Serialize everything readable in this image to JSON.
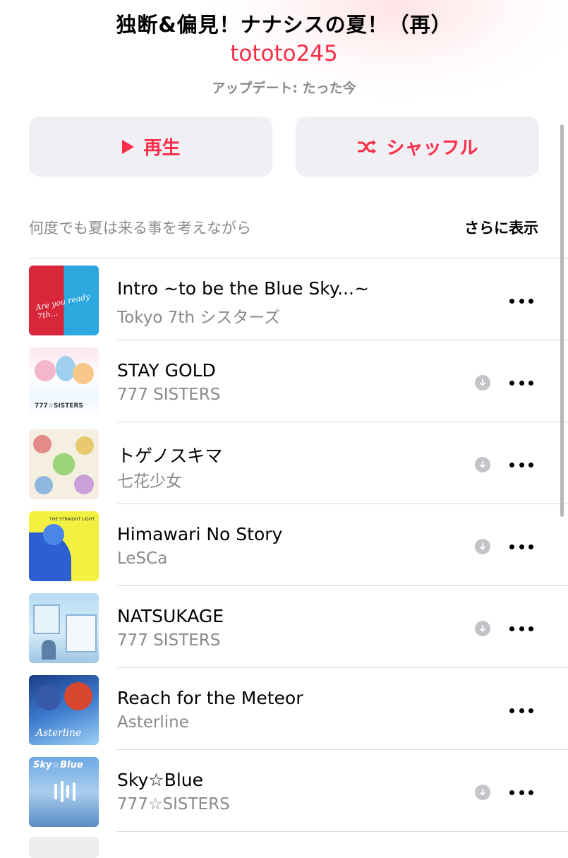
{
  "header": {
    "title": "独断&偏見！ナナシスの夏！（再）",
    "curator": "tototo245",
    "updated": "アップデート: たった今"
  },
  "actions": {
    "play_label": "再生",
    "shuffle_label": "シャッフル"
  },
  "description": {
    "text": "何度でも夏は来る事を考えながら",
    "more_label": "さらに表示"
  },
  "colors": {
    "accent": "#fa2d48",
    "secondary_text": "#8a8a8e",
    "button_bg": "#efeff4"
  },
  "tracks": [
    {
      "title": "Intro ~to be the Blue Sky...~",
      "artist": "Tokyo 7th シスターズ",
      "downloaded_icon": false,
      "art_text": "Are you ready 7th..."
    },
    {
      "title": "STAY GOLD",
      "artist": "777 SISTERS",
      "downloaded_icon": true,
      "art_text": "777☆SISTERS"
    },
    {
      "title": "トゲノスキマ",
      "artist": "七花少女",
      "downloaded_icon": true
    },
    {
      "title": "Himawari No Story",
      "artist": "LeSCa",
      "downloaded_icon": true,
      "art_text": "THE STRAIGHT LIGHT"
    },
    {
      "title": "NATSUKAGE",
      "artist": "777 SISTERS",
      "downloaded_icon": true
    },
    {
      "title": "Reach for the Meteor",
      "artist": "Asterline",
      "downloaded_icon": false,
      "art_text": "Asterline"
    },
    {
      "title": "Sky☆Blue",
      "artist": "777☆SISTERS",
      "downloaded_icon": true,
      "now_playing": true,
      "art_text": "Sky☆Blue"
    }
  ]
}
